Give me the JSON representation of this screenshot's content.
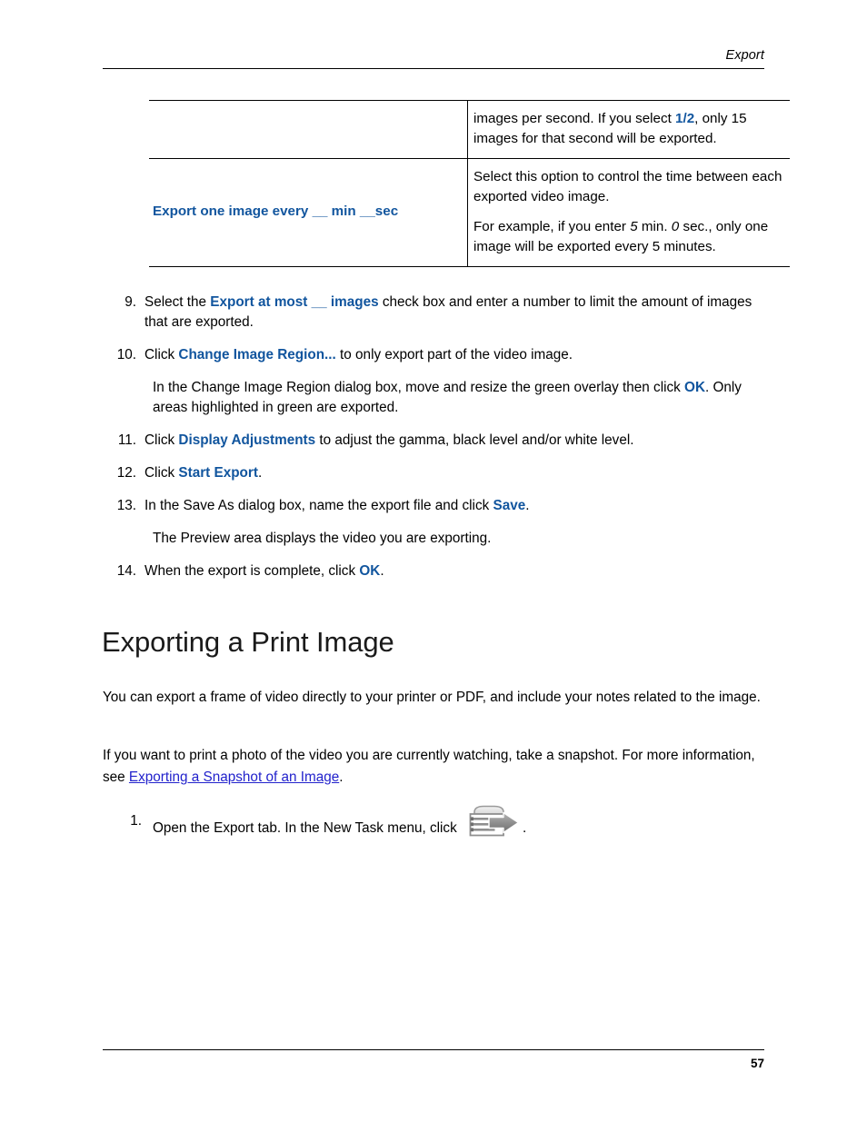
{
  "header": {
    "running_title": "Export"
  },
  "table": {
    "rows": [
      {
        "label": "",
        "cells": [
          {
            "segments": [
              {
                "text": "images per second. If you select ",
                "style": "normal"
              },
              {
                "text": "1/2",
                "style": "uiterm"
              },
              {
                "text": ", only 15 images for that second will be exported.",
                "style": "normal"
              }
            ],
            "plain": "images per second. If you select 1/2, only 15 images for that second will be exported."
          }
        ]
      },
      {
        "label": "Export one image every __ min __sec",
        "cells": [
          {
            "plain": "Select this option to control the time between each exported video image."
          },
          {
            "plain": "For example, if you enter 5 min. 0 sec., only one image will be exported every 5 minutes."
          }
        ]
      }
    ],
    "row1_text_pre": "images per second. If you select ",
    "row1_bold": "1/2",
    "row1_text_post": ", only 15 images for that second will be exported.",
    "row2_label": "Export one image every __ min __sec",
    "row2_para1": "Select this option to control the time between each exported video image.",
    "row2_para2_pre": "For example, if you enter ",
    "row2_para2_val1": "5",
    "row2_para2_mid": " min. ",
    "row2_para2_val2": "0",
    "row2_para2_post": " sec., only one image will be exported every 5 minutes."
  },
  "steps": {
    "s9": {
      "num": "9.",
      "pre": "Select the ",
      "term": "Export at most __ images",
      "post": " check box and enter a number to limit the amount of images that are exported."
    },
    "s10": {
      "num": "10.",
      "pre": "Click ",
      "term": "Change Image Region...",
      "post": " to only export part of the video image.",
      "sub_pre": "In the Change Image Region dialog box, move and resize the green overlay then click ",
      "sub_term": "OK",
      "sub_post": ". Only areas highlighted in green are exported."
    },
    "s11": {
      "num": "11.",
      "pre": "Click ",
      "term": "Display Adjustments",
      "post": " to adjust the gamma, black level and/or white level."
    },
    "s12": {
      "num": "12.",
      "pre": "Click ",
      "term": "Start Export",
      "post": "."
    },
    "s13": {
      "num": "13.",
      "pre": "In the Save As dialog box, name the export file and click ",
      "term": "Save",
      "post": ".",
      "sub": "The Preview area displays the video you are exporting."
    },
    "s14": {
      "num": "14.",
      "pre": "When the export is complete, click ",
      "term": "OK",
      "post": "."
    }
  },
  "section": {
    "heading": "Exporting a Print Image",
    "para1": "You can export a frame of video directly to your printer or PDF, and include your notes related to the image.",
    "para2_pre": "If you want to print a photo of the video you are currently watching, take a snapshot. For more information, see ",
    "para2_link": "Exporting a Snapshot of an Image",
    "para2_post": "."
  },
  "steps2": {
    "s1": {
      "num": "1.",
      "pre": "Open the Export tab. In the New Task menu, click ",
      "icon": "export-image-icon",
      "post": "."
    }
  },
  "footer": {
    "page_number": "57"
  },
  "colors": {
    "ui_term_blue": "#11559E",
    "link_blue": "#2222CC",
    "rule_black": "#000000",
    "icon_gray": "#8C8C8C"
  }
}
